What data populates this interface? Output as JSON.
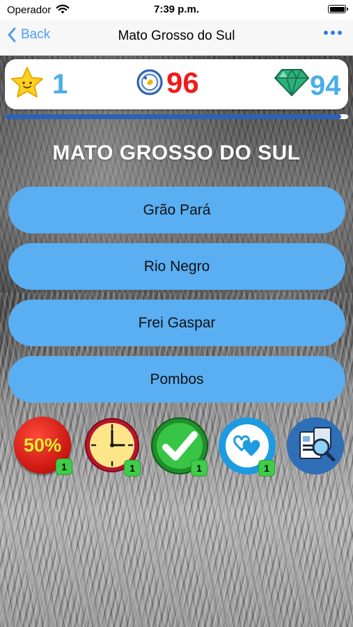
{
  "status_bar": {
    "carrier": "Operador",
    "time": "7:39 p.m."
  },
  "nav": {
    "back_label": "Back",
    "title": "Mato Grosso do Sul"
  },
  "score": {
    "stars": "1",
    "coins": "96",
    "gems": "94"
  },
  "progress": {
    "fraction": 0.98
  },
  "question": {
    "text": "MATO GROSSO DO SUL"
  },
  "answers": [
    "Grão Pará",
    "Rio Negro",
    "Frei Gaspar",
    "Pombos"
  ],
  "lifelines": {
    "fifty": {
      "label": "50%",
      "count": "1"
    },
    "time": {
      "icon": "clock-icon",
      "count": "1"
    },
    "correct": {
      "icon": "checkmark-icon",
      "count": "1"
    },
    "lives": {
      "icon": "hearts-icon",
      "count": "1"
    },
    "hint": {
      "icon": "search-document-icon"
    }
  },
  "colors": {
    "accent": "#5aaef2",
    "coins": "#ee1c1c",
    "stars": "#4aaee8",
    "progress": "#2b62b8",
    "badge": "#3fcc4a"
  }
}
